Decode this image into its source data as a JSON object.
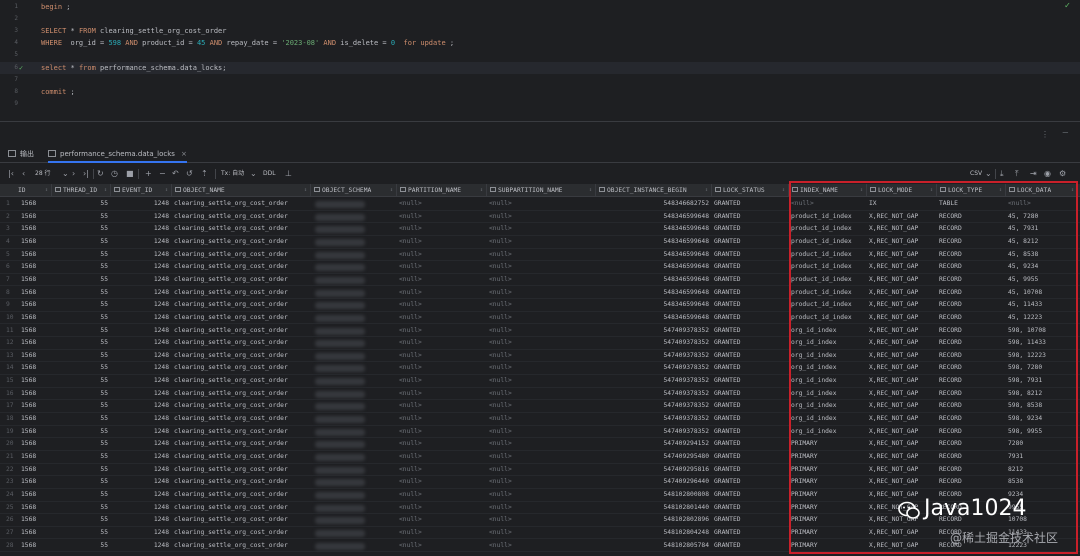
{
  "editor": {
    "lines": [
      {
        "n": "1",
        "tokens": [
          [
            "kw",
            "begin"
          ],
          [
            "pl",
            " ;"
          ]
        ]
      },
      {
        "n": "2",
        "tokens": []
      },
      {
        "n": "3",
        "tokens": [
          [
            "kw",
            "SELECT"
          ],
          [
            "pl",
            " * "
          ],
          [
            "kw",
            "FROM"
          ],
          [
            "pl",
            " clearing_settle_org_cost_order"
          ]
        ]
      },
      {
        "n": "4",
        "tokens": [
          [
            "kw",
            "WHERE"
          ],
          [
            "pl",
            "  org_id = "
          ],
          [
            "num",
            "598"
          ],
          [
            "kw",
            " AND"
          ],
          [
            "pl",
            " product_id = "
          ],
          [
            "num",
            "45"
          ],
          [
            "kw",
            " AND"
          ],
          [
            "pl",
            " repay_date = "
          ],
          [
            "str",
            "'2023-08'"
          ],
          [
            "kw",
            " AND"
          ],
          [
            "pl",
            " is_delete = "
          ],
          [
            "num",
            "0"
          ],
          [
            "kw",
            "  for update"
          ],
          [
            "pl",
            " ;"
          ]
        ]
      },
      {
        "n": "5",
        "tokens": []
      },
      {
        "n": "6",
        "tokens": [
          [
            "kw",
            "select"
          ],
          [
            "pl",
            " * "
          ],
          [
            "kw",
            "from"
          ],
          [
            "pl",
            " performance_schema.data_locks;"
          ]
        ],
        "check": true
      },
      {
        "n": "7",
        "tokens": []
      },
      {
        "n": "8",
        "tokens": [
          [
            "kw",
            "commit"
          ],
          [
            "pl",
            " ;"
          ]
        ]
      },
      {
        "n": "9",
        "tokens": []
      }
    ]
  },
  "tabs": [
    {
      "label": "输出",
      "icon": "output-icon"
    },
    {
      "label": "performance_schema.data_locks",
      "icon": "table-icon",
      "active": true,
      "close": "×"
    }
  ],
  "toolbar": {
    "rows_label": "28 行",
    "tx_label": "Tx: 自动",
    "ddl_label": "DDL",
    "format_label": "CSV"
  },
  "columns": [
    "ID",
    "THREAD_ID",
    "EVENT_ID",
    "OBJECT_NAME",
    "OBJECT_SCHEMA",
    "PARTITION_NAME",
    "SUBPARTITION_NAME",
    "OBJECT_INSTANCE_BEGIN",
    "LOCK_STATUS",
    "INDEX_NAME",
    "LOCK_MODE",
    "LOCK_TYPE",
    "LOCK_DATA"
  ],
  "rows": [
    [
      "1",
      "1568",
      "55",
      "1248",
      "clearing_settle_org_cost_order",
      "",
      "<null>",
      "<null>",
      "548346682752",
      "GRANTED",
      "<null>",
      "IX",
      "TABLE",
      "<null>"
    ],
    [
      "2",
      "1568",
      "55",
      "1248",
      "clearing_settle_org_cost_order",
      "",
      "<null>",
      "<null>",
      "548346599648",
      "GRANTED",
      "product_id_index",
      "X,REC_NOT_GAP",
      "RECORD",
      "45, 7280"
    ],
    [
      "3",
      "1568",
      "55",
      "1248",
      "clearing_settle_org_cost_order",
      "",
      "<null>",
      "<null>",
      "548346599648",
      "GRANTED",
      "product_id_index",
      "X,REC_NOT_GAP",
      "RECORD",
      "45, 7931"
    ],
    [
      "4",
      "1568",
      "55",
      "1248",
      "clearing_settle_org_cost_order",
      "",
      "<null>",
      "<null>",
      "548346599648",
      "GRANTED",
      "product_id_index",
      "X,REC_NOT_GAP",
      "RECORD",
      "45, 8212"
    ],
    [
      "5",
      "1568",
      "55",
      "1248",
      "clearing_settle_org_cost_order",
      "",
      "<null>",
      "<null>",
      "548346599648",
      "GRANTED",
      "product_id_index",
      "X,REC_NOT_GAP",
      "RECORD",
      "45, 8538"
    ],
    [
      "6",
      "1568",
      "55",
      "1248",
      "clearing_settle_org_cost_order",
      "",
      "<null>",
      "<null>",
      "548346599648",
      "GRANTED",
      "product_id_index",
      "X,REC_NOT_GAP",
      "RECORD",
      "45, 9234"
    ],
    [
      "7",
      "1568",
      "55",
      "1248",
      "clearing_settle_org_cost_order",
      "",
      "<null>",
      "<null>",
      "548346599648",
      "GRANTED",
      "product_id_index",
      "X,REC_NOT_GAP",
      "RECORD",
      "45, 9955"
    ],
    [
      "8",
      "1568",
      "55",
      "1248",
      "clearing_settle_org_cost_order",
      "",
      "<null>",
      "<null>",
      "548346599648",
      "GRANTED",
      "product_id_index",
      "X,REC_NOT_GAP",
      "RECORD",
      "45, 10708"
    ],
    [
      "9",
      "1568",
      "55",
      "1248",
      "clearing_settle_org_cost_order",
      "",
      "<null>",
      "<null>",
      "548346599648",
      "GRANTED",
      "product_id_index",
      "X,REC_NOT_GAP",
      "RECORD",
      "45, 11433"
    ],
    [
      "10",
      "1568",
      "55",
      "1248",
      "clearing_settle_org_cost_order",
      "",
      "<null>",
      "<null>",
      "548346599648",
      "GRANTED",
      "product_id_index",
      "X,REC_NOT_GAP",
      "RECORD",
      "45, 12223"
    ],
    [
      "11",
      "1568",
      "55",
      "1248",
      "clearing_settle_org_cost_order",
      "",
      "<null>",
      "<null>",
      "547409378352",
      "GRANTED",
      "org_id_index",
      "X,REC_NOT_GAP",
      "RECORD",
      "598, 10708"
    ],
    [
      "12",
      "1568",
      "55",
      "1248",
      "clearing_settle_org_cost_order",
      "",
      "<null>",
      "<null>",
      "547409378352",
      "GRANTED",
      "org_id_index",
      "X,REC_NOT_GAP",
      "RECORD",
      "598, 11433"
    ],
    [
      "13",
      "1568",
      "55",
      "1248",
      "clearing_settle_org_cost_order",
      "",
      "<null>",
      "<null>",
      "547409378352",
      "GRANTED",
      "org_id_index",
      "X,REC_NOT_GAP",
      "RECORD",
      "598, 12223"
    ],
    [
      "14",
      "1568",
      "55",
      "1248",
      "clearing_settle_org_cost_order",
      "",
      "<null>",
      "<null>",
      "547409378352",
      "GRANTED",
      "org_id_index",
      "X,REC_NOT_GAP",
      "RECORD",
      "598, 7280"
    ],
    [
      "15",
      "1568",
      "55",
      "1248",
      "clearing_settle_org_cost_order",
      "",
      "<null>",
      "<null>",
      "547409378352",
      "GRANTED",
      "org_id_index",
      "X,REC_NOT_GAP",
      "RECORD",
      "598, 7931"
    ],
    [
      "16",
      "1568",
      "55",
      "1248",
      "clearing_settle_org_cost_order",
      "",
      "<null>",
      "<null>",
      "547409378352",
      "GRANTED",
      "org_id_index",
      "X,REC_NOT_GAP",
      "RECORD",
      "598, 8212"
    ],
    [
      "17",
      "1568",
      "55",
      "1248",
      "clearing_settle_org_cost_order",
      "",
      "<null>",
      "<null>",
      "547409378352",
      "GRANTED",
      "org_id_index",
      "X,REC_NOT_GAP",
      "RECORD",
      "598, 8538"
    ],
    [
      "18",
      "1568",
      "55",
      "1248",
      "clearing_settle_org_cost_order",
      "",
      "<null>",
      "<null>",
      "547409378352",
      "GRANTED",
      "org_id_index",
      "X,REC_NOT_GAP",
      "RECORD",
      "598, 9234"
    ],
    [
      "19",
      "1568",
      "55",
      "1248",
      "clearing_settle_org_cost_order",
      "",
      "<null>",
      "<null>",
      "547409378352",
      "GRANTED",
      "org_id_index",
      "X,REC_NOT_GAP",
      "RECORD",
      "598, 9955"
    ],
    [
      "20",
      "1568",
      "55",
      "1248",
      "clearing_settle_org_cost_order",
      "",
      "<null>",
      "<null>",
      "547409294152",
      "GRANTED",
      "PRIMARY",
      "X,REC_NOT_GAP",
      "RECORD",
      "7280"
    ],
    [
      "21",
      "1568",
      "55",
      "1248",
      "clearing_settle_org_cost_order",
      "",
      "<null>",
      "<null>",
      "547409295480",
      "GRANTED",
      "PRIMARY",
      "X,REC_NOT_GAP",
      "RECORD",
      "7931"
    ],
    [
      "22",
      "1568",
      "55",
      "1248",
      "clearing_settle_org_cost_order",
      "",
      "<null>",
      "<null>",
      "547409295816",
      "GRANTED",
      "PRIMARY",
      "X,REC_NOT_GAP",
      "RECORD",
      "8212"
    ],
    [
      "23",
      "1568",
      "55",
      "1248",
      "clearing_settle_org_cost_order",
      "",
      "<null>",
      "<null>",
      "547409296440",
      "GRANTED",
      "PRIMARY",
      "X,REC_NOT_GAP",
      "RECORD",
      "8538"
    ],
    [
      "24",
      "1568",
      "55",
      "1248",
      "clearing_settle_org_cost_order",
      "",
      "<null>",
      "<null>",
      "548102800808",
      "GRANTED",
      "PRIMARY",
      "X,REC_NOT_GAP",
      "RECORD",
      "9234"
    ],
    [
      "25",
      "1568",
      "55",
      "1248",
      "clearing_settle_org_cost_order",
      "",
      "<null>",
      "<null>",
      "548102801440",
      "GRANTED",
      "PRIMARY",
      "X,REC_NOT_GAP",
      "RECORD",
      "9955"
    ],
    [
      "26",
      "1568",
      "55",
      "1248",
      "clearing_settle_org_cost_order",
      "",
      "<null>",
      "<null>",
      "548102802896",
      "GRANTED",
      "PRIMARY",
      "X,REC_NOT_GAP",
      "RECORD",
      "10708"
    ],
    [
      "27",
      "1568",
      "55",
      "1248",
      "clearing_settle_org_cost_order",
      "",
      "<null>",
      "<null>",
      "548102804248",
      "GRANTED",
      "PRIMARY",
      "X,REC_NOT_GAP",
      "RECORD",
      "11433"
    ],
    [
      "28",
      "1568",
      "55",
      "1248",
      "clearing_settle_org_cost_order",
      "",
      "<null>",
      "<null>",
      "548102805784",
      "GRANTED",
      "PRIMARY",
      "X,REC_NOT_GAP",
      "RECORD",
      "12223"
    ]
  ],
  "watermark": {
    "main": "Java1024",
    "sub": "@稀土掘金技术社区"
  },
  "colors": {
    "keyword": "#cf8e6d",
    "string": "#6aab73",
    "number": "#2aacb8",
    "highlight": "#c9202a",
    "accent": "#3574f0"
  }
}
